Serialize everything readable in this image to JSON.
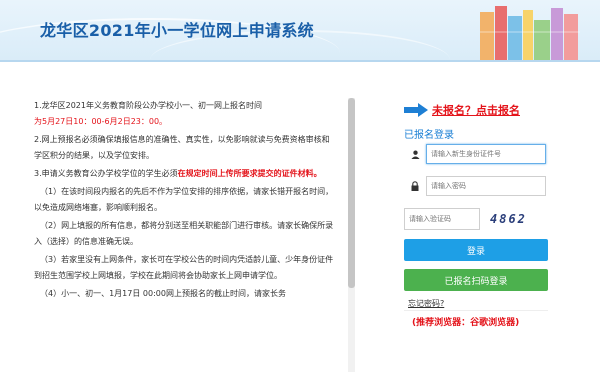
{
  "header": {
    "title": "龙华区2021年小一学位网上申请系统"
  },
  "notice": {
    "p1": "1.龙华区2021年义务教育阶段公办学校小一、初一网上报名时间",
    "p1_time": "为5月27日10：00-6月2日23：00。",
    "p2": "2.网上预报名必须确保填报信息的准确性、真实性，以免影响就读与免费资格审核和学区积分的结果，以及学位安排。",
    "p3_prefix": "3.申请义务教育公办学校学位的学生必须",
    "p3_red": "在规定时间上传所要求提交的证件材料。",
    "p4": "（1）在该时间段内报名的先后不作为学位安排的排序依据，请家长错开报名时间，以免造成网络堵塞，影响顺利报名。",
    "p5": "（2）网上填报的所有信息，都将分别送至相关职能部门进行审核。请家长确保所录入（选择）的信息准确无误。",
    "p6": "（3）若家里没有上网条件，家长可在学校公告的时间内凭适龄儿童、少年身份证件到招生范围学校上网填报，学校在此期间将会协助家长上网申请学位。",
    "p7": "（4）小一、初一、1月17日 00:00网上预报名的截止时间，请家长务"
  },
  "login": {
    "register_link": "未报名？点击报名",
    "panel_title": "已报名登录",
    "id_placeholder": "请输入新生身份证件号",
    "password_placeholder": "请输入密码",
    "captcha_placeholder": "请输入验证码",
    "captcha_text": "4862",
    "login_button": "登录",
    "scan_button": "已报名扫码登录",
    "forgot_link": "忘记密码?",
    "browser_tip": "(推荐浏览器：谷歌浏览器)"
  },
  "colors": {
    "brand_blue": "#1a5fa8",
    "accent_blue": "#1e9fe6",
    "scan_green": "#4cb14e",
    "warning_red": "#e4141b"
  },
  "icons": [
    "user-icon",
    "lock-icon",
    "arrow-right-icon",
    "books-illustration"
  ]
}
